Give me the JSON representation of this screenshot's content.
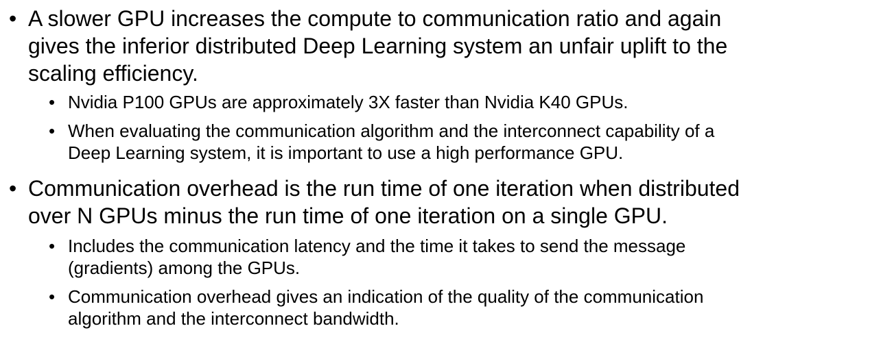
{
  "bullets": [
    {
      "lines": [
        "A slower GPU increases the compute to communication ratio and again",
        "gives the inferior distributed Deep Learning system an unfair uplift to the",
        "scaling efficiency."
      ],
      "sub": [
        {
          "lines": [
            "Nvidia P100 GPUs are approximately 3X faster than Nvidia K40 GPUs."
          ]
        },
        {
          "lines": [
            "When evaluating the communication algorithm and the interconnect capability of a",
            "Deep Learning system, it is important to use a high performance GPU."
          ]
        }
      ]
    },
    {
      "lines": [
        "Communication overhead is the run time of one iteration when distributed",
        "over N GPUs minus the run time of one iteration on a single GPU."
      ],
      "sub": [
        {
          "lines": [
            "Includes the communication latency and the time it takes to send the message",
            "(gradients) among the GPUs."
          ]
        },
        {
          "lines": [
            "Communication overhead gives an indication of the quality of the communication",
            "algorithm and the interconnect bandwidth."
          ]
        }
      ]
    }
  ],
  "bullet_glyph": "•"
}
